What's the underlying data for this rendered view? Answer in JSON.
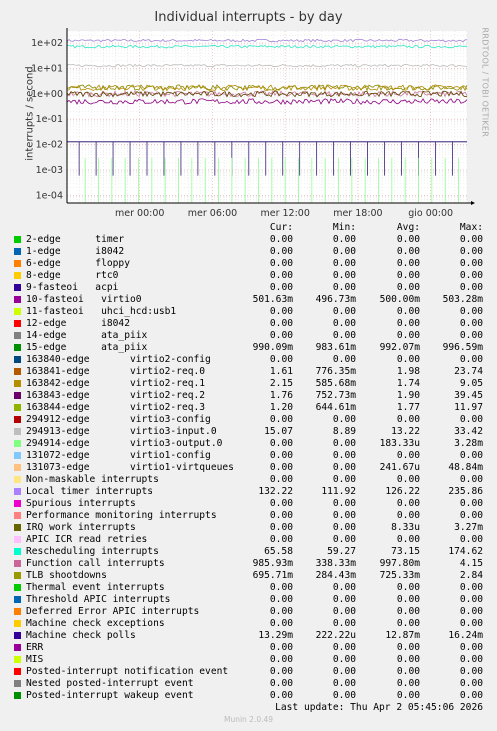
{
  "chart_data": {
    "type": "line",
    "title": "Individual interrupts - by day",
    "ylabel": "interrupts / second",
    "yscale": "log",
    "ylim": [
      5e-05,
      300
    ],
    "ytick_labels": [
      "1e+02",
      "1e+01",
      "1e+00",
      "1e-01",
      "1e-02",
      "1e-03",
      "1e-04"
    ],
    "ytick_values": [
      100,
      10,
      1,
      0.1,
      0.01,
      0.001,
      0.0001
    ],
    "xtick_labels": [
      "mer 00:00",
      "mer 06:00",
      "mer 12:00",
      "mer 18:00",
      "gio 00:00"
    ],
    "xtick_hours": [
      6,
      12,
      18,
      24,
      30
    ],
    "xlim_hours": [
      0,
      33
    ],
    "grid": true,
    "series_lines": [
      {
        "name": "Local timer interrupts",
        "color": "#a07fd6",
        "level": 126
      },
      {
        "name": "Rescheduling interrupts",
        "color": "#2fe8c4",
        "level": 73
      },
      {
        "name": "294913-edge",
        "color": "#bababa",
        "level": 13
      },
      {
        "name": "163844-edge",
        "color": "#8a8a00",
        "level": 1.77
      },
      {
        "name": "163842-edge",
        "color": "#b08a00",
        "level": 1.74
      },
      {
        "name": "Function call interrupts",
        "color": "#c87898",
        "level": 1.0
      },
      {
        "name": "15-edge",
        "color": "#5a4100",
        "level": 0.99
      },
      {
        "name": "10-fasteoi",
        "color": "#8b0080",
        "level": 0.5
      },
      {
        "name": "Machine check polls",
        "color": "#1a006a",
        "level": 0.0129
      }
    ]
  },
  "headers": {
    "cur": "Cur:",
    "min": "Min:",
    "avg": "Avg:",
    "max": "Max:"
  },
  "rows": [
    {
      "color": "#00cc00",
      "label": "2-edge      timer",
      "cur": "0.00",
      "min": "0.00",
      "avg": "0.00",
      "max": "0.00"
    },
    {
      "color": "#0066b3",
      "label": "1-edge      i8042",
      "cur": "0.00",
      "min": "0.00",
      "avg": "0.00",
      "max": "0.00"
    },
    {
      "color": "#ff8000",
      "label": "6-edge      floppy",
      "cur": "0.00",
      "min": "0.00",
      "avg": "0.00",
      "max": "0.00"
    },
    {
      "color": "#ffcc00",
      "label": "8-edge      rtc0",
      "cur": "0.00",
      "min": "0.00",
      "avg": "0.00",
      "max": "0.00"
    },
    {
      "color": "#330099",
      "label": "9-fasteoi   acpi",
      "cur": "0.00",
      "min": "0.00",
      "avg": "0.00",
      "max": "0.00"
    },
    {
      "color": "#990099",
      "label": "10-fasteoi   virtio0",
      "cur": "501.63m",
      "min": "496.73m",
      "avg": "500.00m",
      "max": "503.28m"
    },
    {
      "color": "#ccff00",
      "label": "11-fasteoi   uhci_hcd:usb1",
      "cur": "0.00",
      "min": "0.00",
      "avg": "0.00",
      "max": "0.00"
    },
    {
      "color": "#ff0000",
      "label": "12-edge      i8042",
      "cur": "0.00",
      "min": "0.00",
      "avg": "0.00",
      "max": "0.00"
    },
    {
      "color": "#808080",
      "label": "14-edge      ata_piix",
      "cur": "0.00",
      "min": "0.00",
      "avg": "0.00",
      "max": "0.00"
    },
    {
      "color": "#008f00",
      "label": "15-edge      ata_piix",
      "cur": "990.09m",
      "min": "983.61m",
      "avg": "992.07m",
      "max": "996.59m"
    },
    {
      "color": "#00487d",
      "label": "163840-edge       virtio2-config",
      "cur": "0.00",
      "min": "0.00",
      "avg": "0.00",
      "max": "0.00"
    },
    {
      "color": "#b35a00",
      "label": "163841-edge       virtio2-req.0",
      "cur": "1.61",
      "min": "776.35m",
      "max": "23.74",
      "avg": "1.98"
    },
    {
      "color": "#b38f00",
      "label": "163842-edge       virtio2-req.1",
      "cur": "2.15",
      "min": "585.68m",
      "avg": "1.74",
      "max": "9.05"
    },
    {
      "color": "#6b006b",
      "label": "163843-edge       virtio2-req.2",
      "cur": "1.76",
      "min": "752.73m",
      "avg": "1.90",
      "max": "39.45"
    },
    {
      "color": "#8fb300",
      "label": "163844-edge       virtio2-req.3",
      "cur": "1.20",
      "min": "644.61m",
      "avg": "1.77",
      "max": "11.97"
    },
    {
      "color": "#b30000",
      "label": "294912-edge       virtio3-config",
      "cur": "0.00",
      "min": "0.00",
      "avg": "0.00",
      "max": "0.00"
    },
    {
      "color": "#bebebe",
      "label": "294913-edge       virtio3-input.0",
      "cur": "15.07",
      "min": "8.89",
      "avg": "13.22",
      "max": "33.42"
    },
    {
      "color": "#80ff80",
      "label": "294914-edge       virtio3-output.0",
      "cur": "0.00",
      "min": "0.00",
      "avg": "183.33u",
      "max": "3.28m"
    },
    {
      "color": "#80c9ff",
      "label": "131072-edge       virtio1-config",
      "cur": "0.00",
      "min": "0.00",
      "avg": "0.00",
      "max": "0.00"
    },
    {
      "color": "#ffc080",
      "label": "131073-edge       virtio1-virtqueues",
      "cur": "0.00",
      "min": "0.00",
      "avg": "241.67u",
      "max": "48.84m"
    },
    {
      "color": "#ffe680",
      "label": "Non-maskable interrupts",
      "cur": "0.00",
      "min": "0.00",
      "avg": "0.00",
      "max": "0.00"
    },
    {
      "color": "#aa80ff",
      "label": "Local timer interrupts",
      "cur": "132.22",
      "min": "111.92",
      "avg": "126.22",
      "max": "235.86"
    },
    {
      "color": "#ee00cc",
      "label": "Spurious interrupts",
      "cur": "0.00",
      "min": "0.00",
      "avg": "0.00",
      "max": "0.00"
    },
    {
      "color": "#ff8080",
      "label": "Performance monitoring interrupts",
      "cur": "0.00",
      "min": "0.00",
      "avg": "0.00",
      "max": "0.00"
    },
    {
      "color": "#666600",
      "label": "IRQ work interrupts",
      "cur": "0.00",
      "min": "0.00",
      "avg": "8.33u",
      "max": "3.27m"
    },
    {
      "color": "#ffbfff",
      "label": "APIC ICR read retries",
      "cur": "0.00",
      "min": "0.00",
      "avg": "0.00",
      "max": "0.00"
    },
    {
      "color": "#00ffcc",
      "label": "Rescheduling interrupts",
      "cur": "65.58",
      "min": "59.27",
      "avg": "73.15",
      "max": "174.62"
    },
    {
      "color": "#cc6699",
      "label": "Function call interrupts",
      "cur": "985.93m",
      "min": "338.33m",
      "avg": "997.80m",
      "max": "4.15"
    },
    {
      "color": "#999900",
      "label": "TLB shootdowns",
      "cur": "695.71m",
      "min": "284.43m",
      "avg": "725.33m",
      "max": "2.84"
    },
    {
      "color": "#00cc00",
      "label": "Thermal event interrupts",
      "cur": "0.00",
      "min": "0.00",
      "avg": "0.00",
      "max": "0.00"
    },
    {
      "color": "#0066b3",
      "label": "Threshold APIC interrupts",
      "cur": "0.00",
      "min": "0.00",
      "avg": "0.00",
      "max": "0.00"
    },
    {
      "color": "#ff8000",
      "label": "Deferred Error APIC interrupts",
      "cur": "0.00",
      "min": "0.00",
      "avg": "0.00",
      "max": "0.00"
    },
    {
      "color": "#ffcc00",
      "label": "Machine check exceptions",
      "cur": "0.00",
      "min": "0.00",
      "avg": "0.00",
      "max": "0.00"
    },
    {
      "color": "#330099",
      "label": "Machine check polls",
      "cur": "13.29m",
      "min": "222.22u",
      "avg": "12.87m",
      "max": "16.24m"
    },
    {
      "color": "#990099",
      "label": "ERR",
      "cur": "0.00",
      "min": "0.00",
      "avg": "0.00",
      "max": "0.00"
    },
    {
      "color": "#ccff00",
      "label": "MIS",
      "cur": "0.00",
      "min": "0.00",
      "avg": "0.00",
      "max": "0.00"
    },
    {
      "color": "#ff0000",
      "label": "Posted-interrupt notification event",
      "cur": "0.00",
      "min": "0.00",
      "avg": "0.00",
      "max": "0.00"
    },
    {
      "color": "#808080",
      "label": "Nested posted-interrupt event",
      "cur": "0.00",
      "min": "0.00",
      "avg": "0.00",
      "max": "0.00"
    },
    {
      "color": "#008f00",
      "label": "Posted-interrupt wakeup event",
      "cur": "0.00",
      "min": "0.00",
      "avg": "0.00",
      "max": "0.00"
    }
  ],
  "last_update": "Last update: Thu Apr  2 05:45:06 2026",
  "watermark": "RRDTOOL / TOBI OETIKER",
  "footer": "Munin 2.0.49"
}
